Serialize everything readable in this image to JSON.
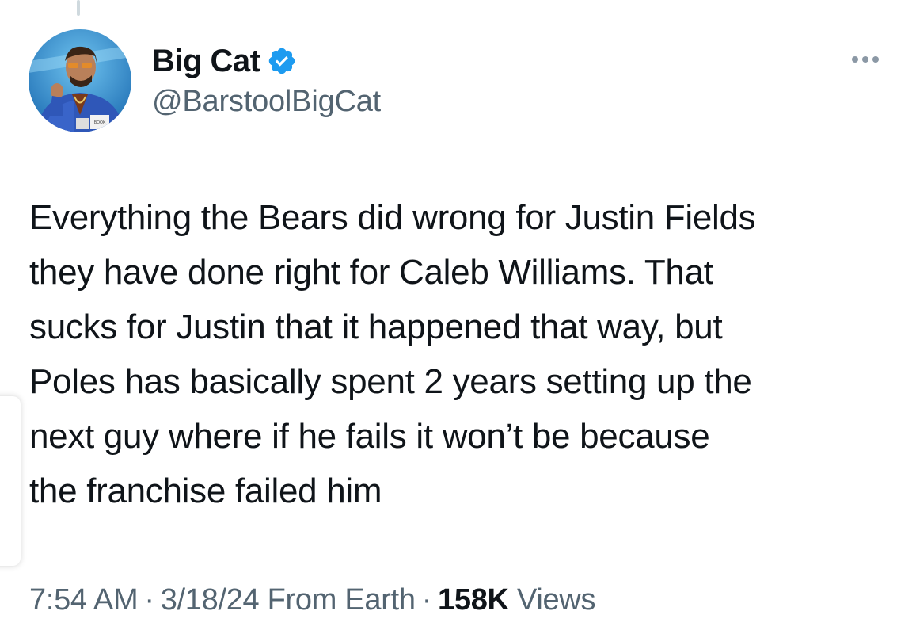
{
  "author": {
    "display_name": "Big Cat",
    "handle": "@BarstoolBigCat",
    "verified": true,
    "verified_color": "#1d9bf0"
  },
  "tweet": {
    "text_lines": [
      "Everything the Bears did wrong for Justin Fields",
      "they have done right for Caleb Williams. That",
      "sucks for Justin that it happened that way, but",
      "Poles has basically spent 2 years setting up the",
      "next guy where if he fails it won’t be because",
      "the franchise failed him"
    ]
  },
  "meta": {
    "time": "7:54 AM",
    "separator": "·",
    "date": "3/18/24",
    "source": "From Earth",
    "views_count": "158K",
    "views_label": "Views"
  },
  "icons": {
    "more": "more-horizontal-icon",
    "verified": "verified-badge-icon"
  },
  "colors": {
    "primary_text": "#0f1419",
    "secondary_text": "#536471",
    "accent": "#1d9bf0"
  }
}
